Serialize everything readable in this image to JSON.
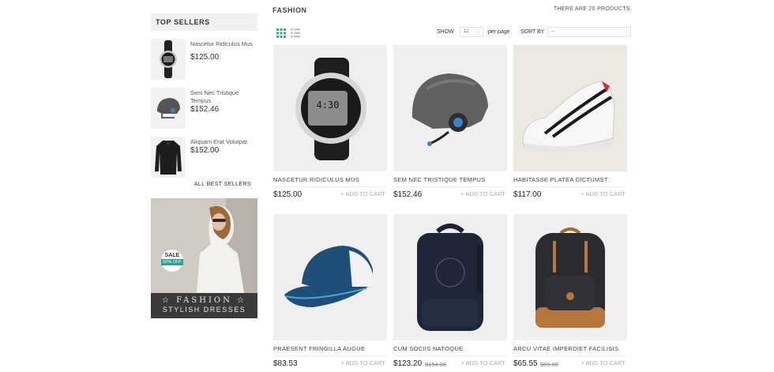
{
  "sidebar": {
    "top_sellers_title": "TOP SELLERS",
    "items": [
      {
        "name": "Nascetur Ridiculus Mus",
        "price": "$125.00",
        "icon": "watch"
      },
      {
        "name": "Sem Nec Tristique Tempus",
        "price": "$152.46",
        "icon": "helmet"
      },
      {
        "name": "Aliquam Erat Volutpat",
        "price": "$152.00",
        "icon": "jacket"
      }
    ],
    "all_best_sellers": "ALL BEST SELLERS",
    "banner": {
      "sale": "SALE",
      "off": "50% OFF",
      "line1": "☆ FASHION ☆",
      "line2": "STYLISH DRESSES"
    }
  },
  "category": {
    "title": "FASHION",
    "count": "THERE ARE 20 PRODUCTS."
  },
  "toolbar": {
    "grid_icon": "grid-view-icon",
    "list_icon": "list-view-icon",
    "show_label": "SHOW",
    "show_value": "12",
    "per_page": "per page",
    "sort_label": "SORT BY",
    "sort_value": "--"
  },
  "products": [
    {
      "name": "NASCETUR RIDICULUS MUS",
      "price": "$125.00",
      "old_price": "",
      "add": "+ ADD TO CART",
      "image": "watch"
    },
    {
      "name": "SEM NEC TRISTIQUE TEMPUS",
      "price": "$152.46",
      "old_price": "",
      "add": "+ ADD TO CART",
      "image": "helmet"
    },
    {
      "name": "HABITASSE PLATEA DICTUMST",
      "price": "$117.00",
      "old_price": "",
      "add": "+ ADD TO CART",
      "image": "sneaker"
    },
    {
      "name": "PRAESENT FRINGILLA AUGUE",
      "price": "$83.53",
      "old_price": "",
      "add": "+ ADD TO CART",
      "image": "cap"
    },
    {
      "name": "CUM SOCIIS NATOQUE",
      "price": "$123.20",
      "old_price": "$154.00",
      "add": "+ ADD TO CART",
      "image": "backpack-navy"
    },
    {
      "name": "ARCU VITAE IMPERDIET FACILISIS",
      "price": "$65.55",
      "old_price": "$69.00",
      "add": "+ ADD TO CART",
      "image": "backpack-grey"
    }
  ],
  "colors": {
    "accent_grid": "#3aa39a",
    "background": "#ffffff",
    "panel": "#f1f1f1"
  }
}
